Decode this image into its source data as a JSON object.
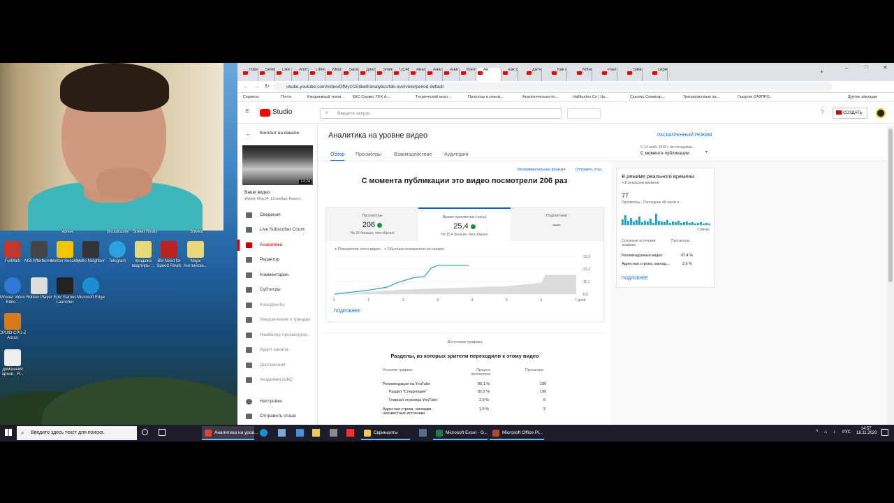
{
  "desktop": {
    "top_labels": [
      "ярлык",
      "Broadcaster",
      "Speed Rivals",
      "Sheets"
    ],
    "icons": [
      {
        "label": "FurMark",
        "color": "#c0392b"
      },
      {
        "label": "MSI Afterburner",
        "color": "#444"
      },
      {
        "label": "Norton Security",
        "color": "#f5c400"
      },
      {
        "label": "Hello Neighbor",
        "color": "#333"
      },
      {
        "label": "Telegram",
        "color": "#2aa3e0"
      },
      {
        "label": "продажа квартиры ...",
        "color": "#e7d87a"
      },
      {
        "label": "Bbl Need for Speed Rivals",
        "color": "#b22"
      },
      {
        "label": "Марк Английски...",
        "color": "#e7d87a"
      },
      {
        "label": "Movavi Video Edito...",
        "color": "#2f7ad6"
      },
      {
        "label": "Roblox Player",
        "color": "#ddd"
      },
      {
        "label": "Epic Games Launcher",
        "color": "#222"
      },
      {
        "label": "Microsoft Edge",
        "color": "#1c8fd2"
      },
      {
        "label": "CPUID CPU-Z Aorus",
        "color": "#d57a1a"
      },
      {
        "label": "домашний архив - Я...",
        "color": "#eee"
      }
    ]
  },
  "browser": {
    "tabs": [
      "Лови",
      "Selen",
      "Like E",
      "Amm",
      "Little",
      "Milun",
      "Sara и",
      "Дешу",
      "Smile",
      "UC4h",
      "Анал",
      "Анал",
      "Анал",
      "Конт",
      "Ан",
      "как сд",
      "датчи",
      "Как по",
      "Kitten",
      "Paul Y",
      "Safari",
      "серж"
    ],
    "url": "studio.youtube.com/video/DfMy1CE6be8/analytics/tab-overview/period-default",
    "bookmarks": [
      "Сервисы",
      "Почта",
      "Ежедневный техни...",
      "БКС Сервис ТЕХ А...",
      "Технический анал...",
      "Прогнозы и реком...",
      "Аналитическая по...",
      "Halliburton Co | Це...",
      "Скачать Семинар...",
      "Тренировочные за...",
      "Газпром (ГАЗПРО...",
      "Другие закладки"
    ]
  },
  "studio": {
    "logo": "Studio",
    "search_placeholder": "Введите запрос",
    "create_label": "СОЗДАТЬ",
    "back_label": "Контент на канале",
    "video_label": "Ваше видео",
    "video_title": "Weekly Vlog 24. 13 ноября. Новост...",
    "video_duration": "14:24",
    "sidebar": [
      {
        "label": "Сведения",
        "active": false
      },
      {
        "label": "Live Subscriber Count",
        "active": false
      },
      {
        "label": "Аналитика",
        "active": true
      },
      {
        "label": "Редактор",
        "active": false
      },
      {
        "label": "Комментарии",
        "active": false
      },
      {
        "label": "Субтитры",
        "active": false
      },
      {
        "label": "Конкуренты",
        "active": false
      },
      {
        "label": "Уведомления о трендах",
        "active": false
      },
      {
        "label": "Наиболее просматрив...",
        "active": false
      },
      {
        "label": "Аудит канала",
        "active": false
      },
      {
        "label": "Достижения",
        "active": false
      },
      {
        "label": "Академия vidIQ",
        "active": false
      },
      {
        "label": "Настройки",
        "active": false
      },
      {
        "label": "Отправить отзыв",
        "active": false
      }
    ],
    "page_title": "Аналитика на уровне видео",
    "advanced_mode": "РАСШИРЕННЫЙ РЕЖИМ",
    "tabs": [
      "Обзор",
      "Просмотры",
      "Взаимодействие",
      "Аудитория"
    ],
    "period_label": "С 14 нояб. 2020 г. по сегодняшн...",
    "period_value": "С момента публикации",
    "experimental": "Экспериментальные функции",
    "send_feedback": "Отправить отзы",
    "headline": "С момента публикации это видео посмотрели 206 раз",
    "metrics": [
      {
        "label": "Просмотры",
        "value": "206",
        "note": "На 26 больше, чем обычно"
      },
      {
        "label": "Время просмотра (часы)",
        "value": "25,4",
        "note": "На 15,4 больше, чем обычно"
      },
      {
        "label": "Подписчики",
        "value": "—",
        "note": ""
      }
    ],
    "legend": [
      "Показатели этого видео",
      "Обычные показатели на канале"
    ],
    "more_link": "ПОДРОБНЕЕ",
    "traffic_section_label": "Источники трафика",
    "traffic_title": "Разделы, из которых зрители переходили к этому видео",
    "traffic_headers": [
      "Источник трафика",
      "Процент просмотров",
      "Просмотры"
    ],
    "traffic_rows": [
      {
        "source": "Рекомендации на YouTube",
        "percent": "95,1 %",
        "views": "196"
      },
      {
        "source": "Раздел \"Следующее\"",
        "percent": "92,2 %",
        "views": "190"
      },
      {
        "source": "Главная страница YouTube",
        "percent": "2,9 %",
        "views": "6"
      },
      {
        "source": "Адресная строка, закладки, неизвестные источники",
        "percent": "1,5 %",
        "views": "3"
      }
    ],
    "realtime": {
      "title": "В режиме реального времени",
      "subtitle": "В реальном времени",
      "count": "77",
      "count_label": "Просмотры · Последние 48 часов",
      "now_label": "Сейчас",
      "sources_header": "Основные источники трафика",
      "views_header": "Просмотры",
      "sources": [
        {
          "name": "Рекомендуемые видео",
          "percent": "97,4 %"
        },
        {
          "name": "Адресная строка, заклад...",
          "percent": "2,6 %"
        }
      ],
      "more": "ПОДРОБНЕЕ"
    }
  },
  "chart_data": {
    "type": "line",
    "x": [
      0,
      1,
      2,
      3,
      4,
      5,
      6,
      7
    ],
    "x_tick_labels": [
      "0",
      "1",
      "2",
      "3",
      "4",
      "5",
      "6",
      "7 дней"
    ],
    "y_tick_labels": [
      "33,3",
      "22,2",
      "11,1",
      "0,0"
    ],
    "ylim": [
      0,
      33.3
    ],
    "series": [
      {
        "name": "Показатели этого видео",
        "color": "#20a0c0",
        "points": [
          [
            0,
            0
          ],
          [
            0.5,
            1.8
          ],
          [
            1,
            3.5
          ],
          [
            1.5,
            6
          ],
          [
            1.9,
            11
          ],
          [
            2.3,
            14.5
          ],
          [
            2.6,
            15.5
          ],
          [
            2.8,
            23
          ],
          [
            3,
            25.4
          ],
          [
            3.9,
            25.4
          ]
        ]
      },
      {
        "name": "Обычные показатели на канале",
        "color": "#dcdcdc",
        "points": [
          [
            0,
            0
          ],
          [
            1,
            2
          ],
          [
            2,
            4
          ],
          [
            3,
            5
          ],
          [
            4,
            6
          ],
          [
            5,
            7
          ],
          [
            6,
            10
          ],
          [
            6.1,
            17
          ],
          [
            7,
            17
          ]
        ]
      }
    ]
  },
  "taskbar": {
    "search_placeholder": "Введите здесь текст для поиска",
    "apps": [
      {
        "label": "Аналитика на уров...",
        "color": "#e94235",
        "open": true
      },
      {
        "label": "Скриншоты",
        "color": "#f2c94c",
        "open": true
      },
      {
        "label": "Microsoft Excel - G...",
        "color": "#1f7a45",
        "open": true
      },
      {
        "label": "Microsoft Office Pi...",
        "color": "#b7472a",
        "open": true
      }
    ],
    "lang": "РУС",
    "time": "14:57",
    "date": "18.11.2020"
  }
}
